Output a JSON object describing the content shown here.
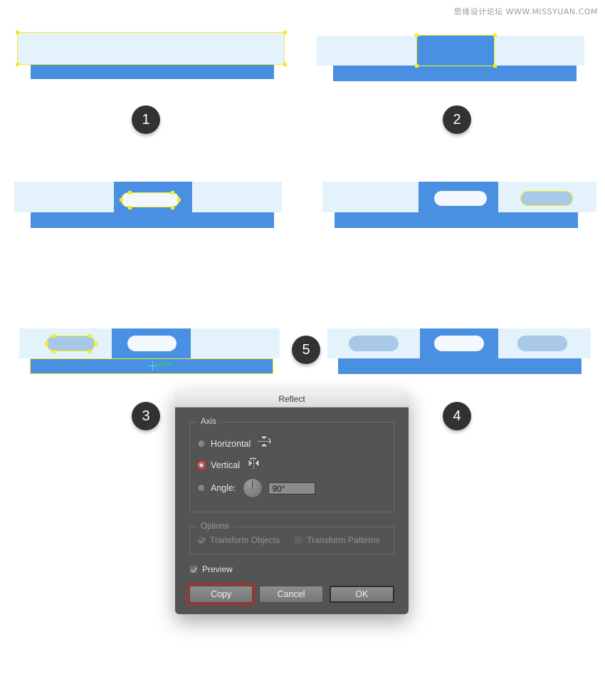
{
  "watermark": "思缘设计论坛  WWW.MISSYUAN.COM",
  "steps": [
    {
      "number": "1",
      "caption_icon": "step-badge-1"
    },
    {
      "number": "2",
      "caption_icon": "step-badge-2"
    },
    {
      "number": "3",
      "caption_icon": "step-badge-3"
    },
    {
      "number": "4",
      "caption_icon": "step-badge-4"
    },
    {
      "number": "5",
      "caption_icon": "step-badge-5"
    }
  ],
  "snap": {
    "label": "center"
  },
  "colors": {
    "blue": "#4a90e2",
    "light_blue": "#e4f2fb",
    "pill_white": "#f2f8fd",
    "pill_steel": "#a8c8e8",
    "selection_yellow": "#f5ec23",
    "badge": "#323232",
    "snap_green": "#23d36a",
    "snap_cyan": "#3de0f0",
    "dialog_bg": "#545454",
    "highlight_red": "#e01b1b"
  },
  "dialog": {
    "title": "Reflect",
    "axis": {
      "legend": "Axis",
      "options": [
        {
          "label": "Horizontal",
          "selected": false,
          "icon": "reflect-horizontal-icon"
        },
        {
          "label": "Vertical",
          "selected": true,
          "icon": "reflect-vertical-icon"
        }
      ],
      "angle": {
        "label": "Angle:",
        "selected": false,
        "value": "90°",
        "dial_icon": "angle-dial"
      }
    },
    "options": {
      "legend": "Options",
      "disabled": true,
      "items": [
        {
          "label": "Transform Objects",
          "checked": true,
          "disabled": true
        },
        {
          "label": "Transform Patterns",
          "checked": false,
          "disabled": true
        }
      ]
    },
    "preview": {
      "label": "Preview",
      "checked": true
    },
    "buttons": [
      {
        "label": "Copy",
        "style": "highlight"
      },
      {
        "label": "Cancel",
        "style": "normal"
      },
      {
        "label": "OK",
        "style": "default"
      }
    ]
  }
}
